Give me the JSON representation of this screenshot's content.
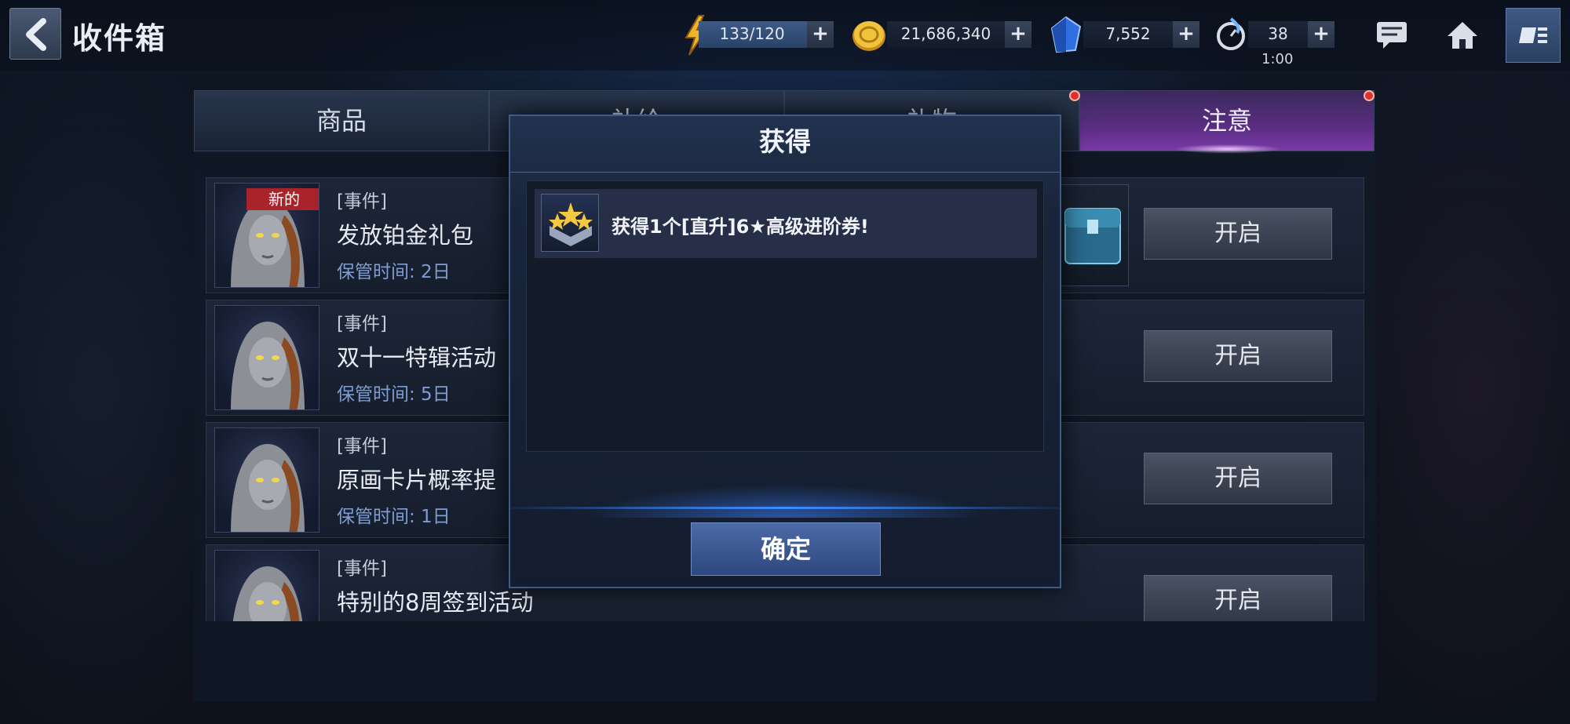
{
  "header": {
    "title": "收件箱",
    "energy": "133/120",
    "gold": "21,686,340",
    "crystals": "7,552",
    "stamina": "38",
    "stamina_timer": "1:00",
    "plus": "+"
  },
  "tabs": [
    {
      "label": "商品",
      "active": false,
      "dot": false
    },
    {
      "label": "补给",
      "active": false,
      "dot": false
    },
    {
      "label": "礼物",
      "active": false,
      "dot": true
    },
    {
      "label": "注意",
      "active": true,
      "dot": true
    }
  ],
  "mail_items": [
    {
      "badge": "新的",
      "tag": "[事件]",
      "title": "发放铂金礼包",
      "keep": "保管时间: 2日",
      "action": "开启"
    },
    {
      "badge": "",
      "tag": "[事件]",
      "title": "双十一特辑活动",
      "keep": "保管时间: 5日",
      "action": "开启"
    },
    {
      "badge": "",
      "tag": "[事件]",
      "title": "原画卡片概率提",
      "keep": "保管时间: 1日",
      "action": "开启"
    },
    {
      "badge": "",
      "tag": "[事件]",
      "title": "特别的8周签到活动",
      "keep": "",
      "action": "开启"
    }
  ],
  "modal": {
    "title": "获得",
    "reward_text": "获得1个[直升]6★高级进阶券!",
    "confirm": "确定"
  },
  "colors": {
    "accent_blue": "#3f8cff",
    "active_tab": "#5a2d82",
    "new_badge": "#a8232a",
    "keep_time": "#7d9ed3"
  }
}
